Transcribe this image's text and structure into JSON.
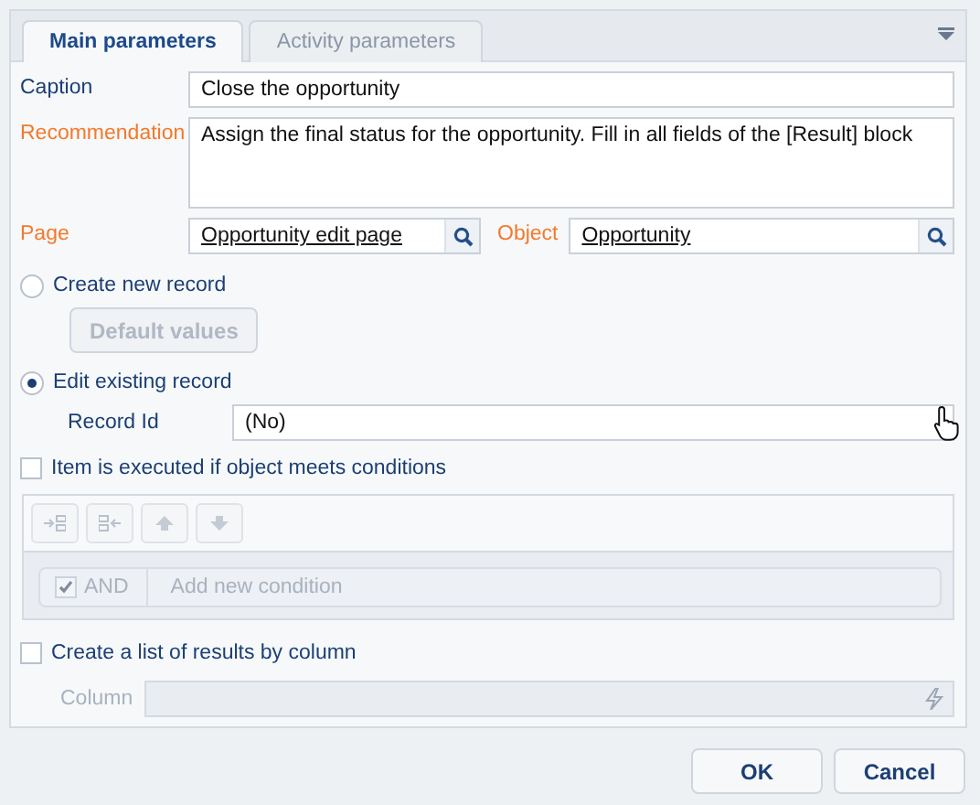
{
  "tabs": [
    {
      "label": "Main parameters",
      "selected": true
    },
    {
      "label": "Activity parameters",
      "selected": false
    }
  ],
  "fields": [
    {
      "kind": "text",
      "label": "Caption",
      "required": false,
      "value": "Close the opportunity"
    },
    {
      "kind": "memo",
      "label": "Recommendation",
      "required": true,
      "value": "Assign the final status for the opportunity. Fill in all fields of the [Result] block"
    }
  ],
  "lookups": [
    {
      "label": "Page",
      "required": true,
      "value": "Opportunity edit page"
    },
    {
      "label": "Object",
      "required": true,
      "value": "Opportunity"
    }
  ],
  "modes": [
    {
      "label": "Create new record",
      "selected": false,
      "button": {
        "label": "Default values",
        "disabled": true
      }
    },
    {
      "label": "Edit existing record",
      "selected": true,
      "field": {
        "label": "Record Id",
        "value": "(No)"
      }
    }
  ],
  "condition": {
    "label": "Item is executed if object meets conditions",
    "checked": false,
    "disabled": true,
    "and_label": "AND",
    "and_checked": true,
    "add_label": "Add new condition"
  },
  "results": {
    "label": "Create a list of results by column",
    "checked": false,
    "column": {
      "label": "Column",
      "disabled": true
    }
  },
  "buttons": [
    "OK",
    "Cancel"
  ]
}
